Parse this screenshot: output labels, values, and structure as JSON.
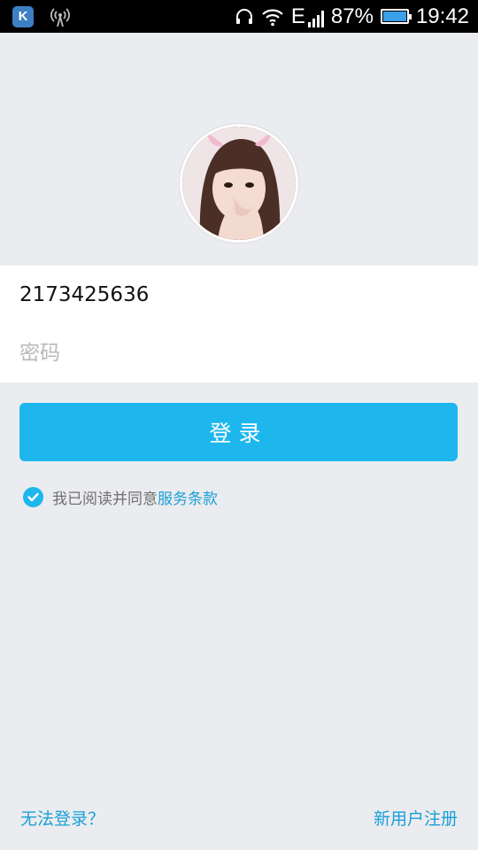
{
  "status_bar": {
    "battery_percent": "87%",
    "time": "19:42",
    "network_type": "E",
    "left_icons": [
      "app-k-icon",
      "hotspot-icon"
    ],
    "right_icons": [
      "headset-icon",
      "wifi-icon",
      "signal-icon",
      "battery-icon"
    ],
    "app_icon_letter": "K"
  },
  "login": {
    "account_value": "2173425636",
    "password_placeholder": "密码",
    "login_button": "登录",
    "agree_text": "我已阅读并同意",
    "terms_link": "服务条款",
    "agree_checked": true
  },
  "footer": {
    "cannot_login": "无法登录？",
    "register": "新用户注册"
  },
  "colors": {
    "accent": "#1db7ee",
    "link": "#1a9fd8",
    "background": "#ebecef"
  }
}
